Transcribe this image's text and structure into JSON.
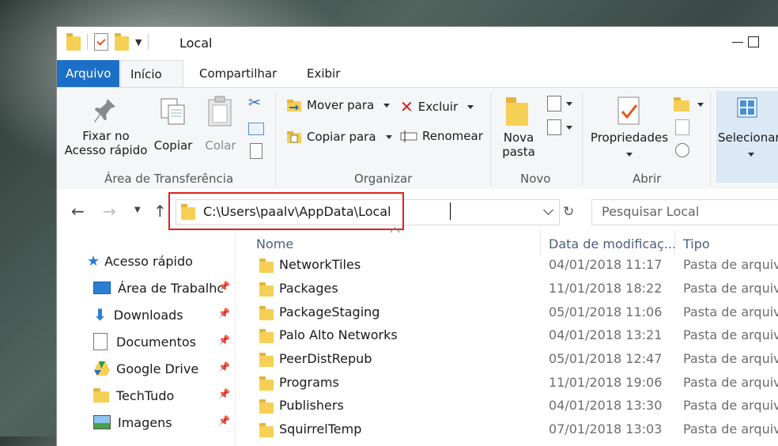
{
  "window": {
    "title": "Local",
    "tabs": [
      {
        "label": "Arquivo"
      },
      {
        "label": "Início"
      },
      {
        "label": "Compartilhar"
      },
      {
        "label": "Exibir"
      }
    ]
  },
  "ribbon": {
    "clipboard": {
      "group_label": "Área de Transferência",
      "pin_label_1": "Fixar no",
      "pin_label_2": "Acesso rápido",
      "copy_label": "Copiar",
      "paste_label": "Colar"
    },
    "organize": {
      "group_label": "Organizar",
      "move_label": "Mover para",
      "copy_to_label": "Copiar para",
      "delete_label": "Excluir",
      "rename_label": "Renomear"
    },
    "new": {
      "group_label": "Novo",
      "new_folder_1": "Nova",
      "new_folder_2": "pasta"
    },
    "open": {
      "group_label": "Abrir",
      "properties_label": "Propriedades"
    },
    "select": {
      "select_label": "Selecionar"
    }
  },
  "address": {
    "path": "C:\\Users\\paalv\\AppData\\Local",
    "search_placeholder": "Pesquisar Local"
  },
  "nav": {
    "items": [
      {
        "label": "Acesso rápido",
        "icon": "star-icon"
      },
      {
        "label": "Área de Trabalhc",
        "icon": "desktop-icon"
      },
      {
        "label": "Downloads",
        "icon": "download-icon"
      },
      {
        "label": "Documentos",
        "icon": "documents-icon"
      },
      {
        "label": "Google Drive",
        "icon": "google-drive-icon"
      },
      {
        "label": "TechTudo",
        "icon": "folder-check-icon"
      },
      {
        "label": "Imagens",
        "icon": "images-icon"
      }
    ]
  },
  "columns": {
    "name": "Nome",
    "date": "Data de modificaç...",
    "type": "Tipo"
  },
  "files": [
    {
      "name": "NetworkTiles",
      "date": "04/01/2018 11:17",
      "type": "Pasta de arquivo"
    },
    {
      "name": "Packages",
      "date": "11/01/2018 18:22",
      "type": "Pasta de arquivo"
    },
    {
      "name": "PackageStaging",
      "date": "05/01/2018 11:06",
      "type": "Pasta de arquivo"
    },
    {
      "name": "Palo Alto Networks",
      "date": "04/01/2018 13:21",
      "type": "Pasta de arquivo"
    },
    {
      "name": "PeerDistRepub",
      "date": "05/01/2018 12:47",
      "type": "Pasta de arquivo"
    },
    {
      "name": "Programs",
      "date": "11/01/2018 19:06",
      "type": "Pasta de arquivo"
    },
    {
      "name": "Publishers",
      "date": "04/01/2018 13:30",
      "type": "Pasta de arquivo"
    },
    {
      "name": "SquirrelTemp",
      "date": "07/01/2018 13:03",
      "type": "Pasta de arquivo"
    }
  ],
  "colors": {
    "accent": "#1c6fc6",
    "folder": "#f6cf55",
    "highlight_box": "#e01f1f"
  }
}
